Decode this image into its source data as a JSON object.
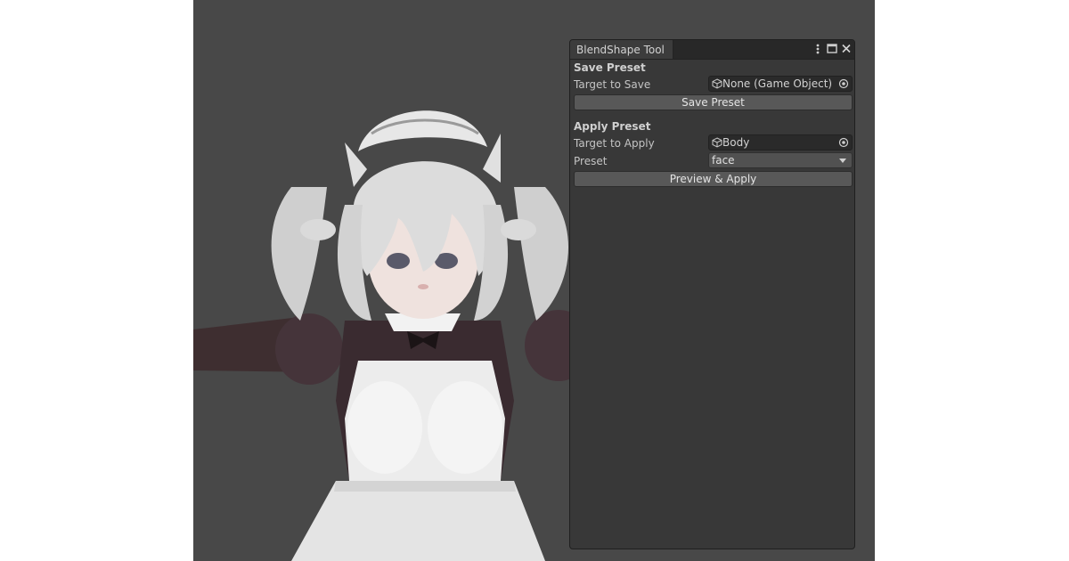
{
  "window": {
    "tab_title": "BlendShape Tool",
    "menu_icon": "kebab-menu-icon",
    "maximize_icon": "maximize-icon",
    "close_icon": "close-icon"
  },
  "save_preset": {
    "section_title": "Save Preset",
    "target_label": "Target to Save",
    "target_value": "None (Game Object)",
    "button_label": "Save Preset"
  },
  "apply_preset": {
    "section_title": "Apply Preset",
    "target_label": "Target to Apply",
    "target_value": "Body",
    "preset_label": "Preset",
    "preset_value": "face",
    "button_label": "Preview & Apply"
  },
  "colors": {
    "viewport_bg": "#484848",
    "window_bg": "#383838",
    "button_bg": "#585858"
  }
}
